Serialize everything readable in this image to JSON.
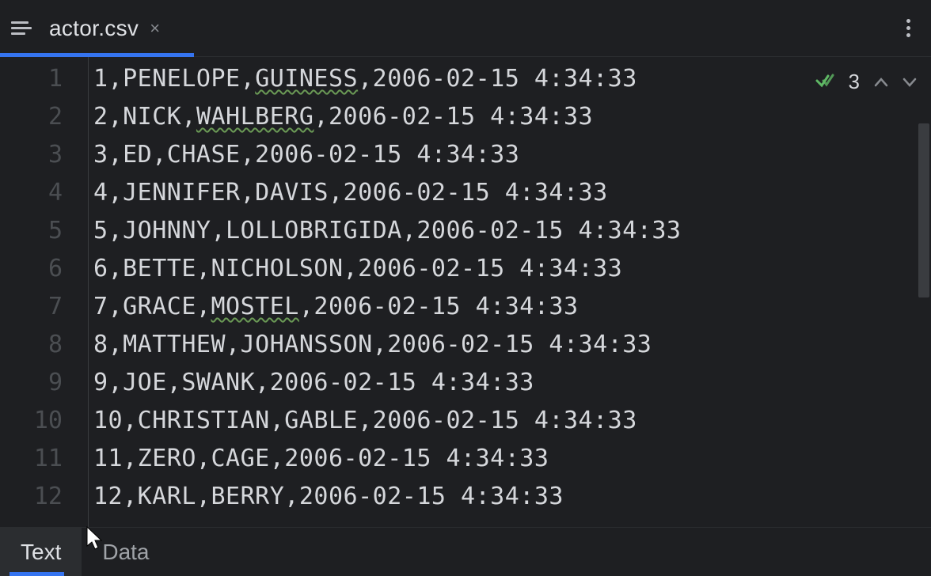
{
  "header": {
    "filename": "actor.csv",
    "close_label": "×"
  },
  "inspections": {
    "count": "3"
  },
  "lines": [
    {
      "num": "1",
      "pre": "1,PENELOPE,",
      "sq": "GUINESS",
      "post": ",2006-02-15 4:34:33"
    },
    {
      "num": "2",
      "pre": "2,NICK,",
      "sq": "WAHLBERG",
      "post": ",2006-02-15 4:34:33"
    },
    {
      "num": "3",
      "pre": "3,ED,CHASE,2006-02-15 4:34:33",
      "sq": "",
      "post": ""
    },
    {
      "num": "4",
      "pre": "4,JENNIFER,DAVIS,2006-02-15 4:34:33",
      "sq": "",
      "post": ""
    },
    {
      "num": "5",
      "pre": "5,JOHNNY,LOLLOBRIGIDA,2006-02-15 4:34:33",
      "sq": "",
      "post": ""
    },
    {
      "num": "6",
      "pre": "6,BETTE,NICHOLSON,2006-02-15 4:34:33",
      "sq": "",
      "post": ""
    },
    {
      "num": "7",
      "pre": "7,GRACE,",
      "sq": "MOSTEL",
      "post": ",2006-02-15 4:34:33"
    },
    {
      "num": "8",
      "pre": "8,MATTHEW,JOHANSSON,2006-02-15 4:34:33",
      "sq": "",
      "post": ""
    },
    {
      "num": "9",
      "pre": "9,JOE,SWANK,2006-02-15 4:34:33",
      "sq": "",
      "post": ""
    },
    {
      "num": "10",
      "pre": "10,CHRISTIAN,GABLE,2006-02-15 4:34:33",
      "sq": "",
      "post": ""
    },
    {
      "num": "11",
      "pre": "11,ZERO,CAGE,2006-02-15 4:34:33",
      "sq": "",
      "post": ""
    },
    {
      "num": "12",
      "pre": "12,KARL,BERRY,2006-02-15 4:34:33",
      "sq": "",
      "post": ""
    }
  ],
  "footer": {
    "tab_text": "Text",
    "tab_data": "Data"
  }
}
